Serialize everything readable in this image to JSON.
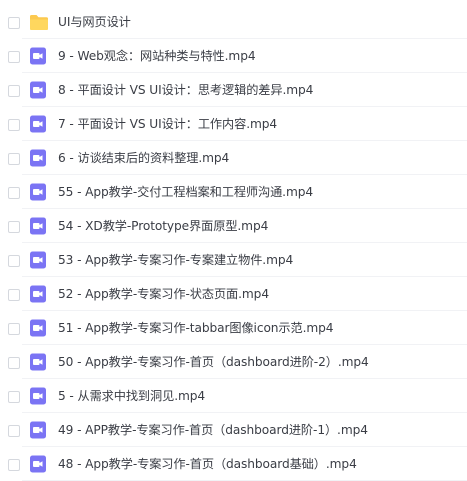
{
  "icons": {
    "folder": "folder-icon",
    "video": "video-file-icon",
    "checkbox": "checkbox"
  },
  "colors": {
    "folder": "#fcc94f",
    "video": "#7b74f4",
    "text": "#3a3d45"
  },
  "files": [
    {
      "type": "folder",
      "name": "UI与网页设计"
    },
    {
      "type": "video",
      "name": "9 - Web观念：网站种类与特性.mp4"
    },
    {
      "type": "video",
      "name": "8 - 平面设计 VS UI设计：思考逻辑的差异.mp4"
    },
    {
      "type": "video",
      "name": "7 - 平面设计 VS UI设计：工作内容.mp4"
    },
    {
      "type": "video",
      "name": "6 - 访谈结束后的资料整理.mp4"
    },
    {
      "type": "video",
      "name": "55 - App教学-交付工程档案和工程师沟通.mp4"
    },
    {
      "type": "video",
      "name": "54 - XD教学-Prototype界面原型.mp4"
    },
    {
      "type": "video",
      "name": "53 - App教学-专案习作-专案建立物件.mp4"
    },
    {
      "type": "video",
      "name": "52 - App教学-专案习作-状态页面.mp4"
    },
    {
      "type": "video",
      "name": "51 - App教学-专案习作-tabbar图像icon示范.mp4"
    },
    {
      "type": "video",
      "name": "50 - App教学-专案习作-首页（dashboard进阶-2）.mp4"
    },
    {
      "type": "video",
      "name": "5 - 从需求中找到洞见.mp4"
    },
    {
      "type": "video",
      "name": "49 - APP教学-专案习作-首页（dashboard进阶-1）.mp4"
    },
    {
      "type": "video",
      "name": "48 - App教学-专案习作-首页（dashboard基础）.mp4"
    }
  ]
}
